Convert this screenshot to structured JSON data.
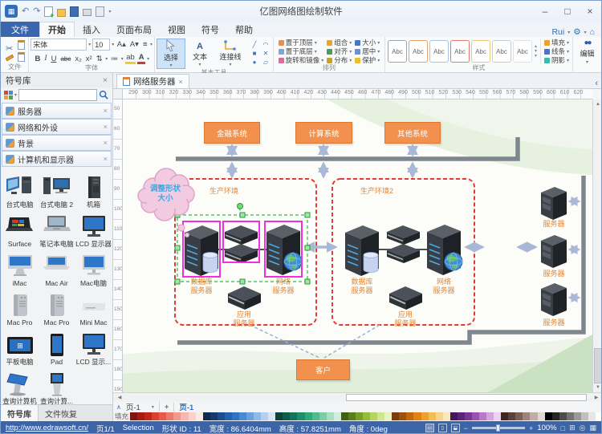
{
  "window": {
    "title": "亿图网络图绘制软件",
    "minimize": "–",
    "maximize": "□",
    "close": "×"
  },
  "menu": {
    "file_tab": "文件",
    "tabs": [
      "开始",
      "插入",
      "页面布局",
      "视图",
      "符号",
      "帮助"
    ],
    "active_tab": "开始",
    "account": "Rui",
    "gear": "⚙",
    "home": "⌂"
  },
  "ribbon": {
    "groups": {
      "file": "文件",
      "font": "字体",
      "tools": "基本工具",
      "arrange": "排列",
      "style": "样式"
    },
    "font": {
      "family": "宋体",
      "size": "10",
      "bold": "B",
      "italic": "I",
      "underline": "U",
      "strike": "abc",
      "sub": "x₂",
      "sup": "x²",
      "grow": "A▴",
      "shrink": "A▾",
      "align": "≡",
      "spacing": "⇅",
      "list": "≔",
      "highlight": "ab",
      "color": "A"
    },
    "tools": {
      "select": "选择",
      "text": "文本",
      "connector": "连接线",
      "shapes": [
        "╱",
        "◠",
        "■",
        "✕",
        "●",
        "▱"
      ]
    },
    "arrange_cols": [
      [
        {
          "label": "置于顶层",
          "color": "#e8914e"
        },
        {
          "label": "置于底层",
          "color": "#7aa7d8"
        },
        {
          "label": "旋转和镜像",
          "color": "#e06a9a"
        }
      ],
      [
        {
          "label": "组合",
          "color": "#e8a33c"
        },
        {
          "label": "对齐",
          "color": "#4a9e5c"
        },
        {
          "label": "分布",
          "color": "#c8a030"
        }
      ],
      [
        {
          "label": "大小",
          "color": "#4a74c8"
        },
        {
          "label": "居中",
          "color": "#6a8ed8"
        },
        {
          "label": "保护",
          "color": "#e8c030"
        }
      ]
    ],
    "style_samples": [
      {
        "label": "Abc",
        "border": "#9aa5ae"
      },
      {
        "label": "Abc",
        "border": "#e8a26a"
      },
      {
        "label": "Abc",
        "border": "#a8c4e0"
      },
      {
        "label": "Abc",
        "border": "#e07a6a"
      },
      {
        "label": "Abc",
        "border": "#e8cc7a"
      },
      {
        "label": "Abc",
        "border": "#c4ccd4"
      },
      {
        "label": "Abc",
        "border": "#dde2e6"
      }
    ],
    "style_tools": [
      {
        "label": "填充",
        "color": "#e8a23c"
      },
      {
        "label": "线条",
        "color": "#4a74c8"
      },
      {
        "label": "阴影",
        "color": "#3cb8a8"
      }
    ],
    "edit": "编辑"
  },
  "sidebar": {
    "title": "符号库",
    "close": "×",
    "sections": [
      {
        "label": "服务器"
      },
      {
        "label": "网络和外设"
      },
      {
        "label": "背景"
      },
      {
        "label": "计算机和显示器"
      }
    ],
    "items": [
      {
        "label": "台式电脑",
        "icon": "ic-desktop1"
      },
      {
        "label": "台式电脑 2",
        "icon": "ic-desktop2"
      },
      {
        "label": "机箱",
        "icon": "ic-case"
      },
      {
        "label": "Surface",
        "icon": "ic-surface"
      },
      {
        "label": "笔记本电脑",
        "icon": "ic-laptop"
      },
      {
        "label": "LCD 显示器",
        "icon": "ic-lcd"
      },
      {
        "label": "iMac",
        "icon": "ic-imac"
      },
      {
        "label": "Mac Air",
        "icon": "ic-macair"
      },
      {
        "label": "Mac电脑",
        "icon": "ic-macpc"
      },
      {
        "label": "Mac Pro",
        "icon": "ic-macpro"
      },
      {
        "label": "Mac Pro",
        "icon": "ic-macpro"
      },
      {
        "label": "Mini Mac",
        "icon": "ic-minimac"
      },
      {
        "label": "平板电脑",
        "icon": "ic-tablet"
      },
      {
        "label": "Pad",
        "icon": "ic-pad"
      },
      {
        "label": "LCD 显示...",
        "icon": "ic-lcd"
      },
      {
        "label": "查询计算机",
        "icon": "ic-kiosk"
      },
      {
        "label": "查询计算...",
        "icon": "ic-kiosk2"
      }
    ],
    "bottom_tabs": [
      "符号库",
      "文件恢复"
    ]
  },
  "document": {
    "tab_label": "网络服务器",
    "tab_close": "×",
    "back_chevron": "‹"
  },
  "rulers": {
    "h_start": 290,
    "h_step": 10,
    "h_count": 34,
    "v_start": 50,
    "v_step": 10,
    "v_count": 15
  },
  "pages": {
    "collapse": "∧",
    "dropdown": "页-1",
    "add": "+",
    "tab": "页-1"
  },
  "palette": {
    "label": "填充",
    "colors": [
      "#7f1410",
      "#a61c11",
      "#c2251a",
      "#d9402e",
      "#e55b4b",
      "#ec7b6d",
      "#f19a8f",
      "#f5b7af",
      "#f9d2cd",
      "#fce8e5",
      "#122a52",
      "#173a6e",
      "#1d4c8f",
      "#2561ad",
      "#2f74c4",
      "#4a8ad2",
      "#6ba1dd",
      "#8fb9e8",
      "#b4d0f0",
      "#d6e5f7",
      "#0b4436",
      "#0f5c49",
      "#15755c",
      "#1f8e6b",
      "#2fa87c",
      "#52ba90",
      "#7ccca8",
      "#a8dec2",
      "#d0eede",
      "#425f12",
      "#5b7e1c",
      "#769e28",
      "#94bc3a",
      "#b4d45e",
      "#d2e692",
      "#e9f2c2",
      "#7a3c08",
      "#9c520a",
      "#c0690c",
      "#e08312",
      "#eda02c",
      "#f4bc55",
      "#f8d488",
      "#fbe7b9",
      "#46175c",
      "#5d2478",
      "#793594",
      "#9a52b0",
      "#b87ac8",
      "#d4a6de",
      "#ecd2f0",
      "#3e2723",
      "#5d4037",
      "#7b5e53",
      "#9c837a",
      "#bfaea7",
      "#e0d6d2",
      "#000000",
      "#262626",
      "#4d4d4d",
      "#737373",
      "#999999",
      "#bfbfbf",
      "#e6e6e6",
      "#ffffff"
    ]
  },
  "status": {
    "link": "http://www.edrawsoft.cn/",
    "page": "页1/1",
    "mode": "Selection",
    "shape_id": "形状 ID : 11",
    "width": "宽度 : 86.6404mm",
    "height": "高度 : 57.8251mm",
    "angle": "角度 : 0deg",
    "zoom": "100%"
  },
  "diagram": {
    "systems": [
      "金融系统",
      "计算系统",
      "其他系统"
    ],
    "env1": {
      "label": "生产环境",
      "db": "数据库\n服务器",
      "net": "网络\n服务器",
      "app": "应用\n服务器"
    },
    "env2": {
      "label": "生产环境2",
      "db": "数据库\n服务器",
      "net": "网络\n服务器",
      "app": "应用\n服务器"
    },
    "right_servers": [
      "服务器",
      "服务器",
      "服务器"
    ],
    "client": "客户",
    "callout": "调整形状\n大小",
    "colors": {
      "box_fill": "#f1914d",
      "box_border": "#db7a33",
      "bus": "#7e868e",
      "arrow": "#a9b8d6",
      "env_border": "#e23a3a",
      "label": "#e0873a",
      "selection": "#35b44a",
      "handle": "#9fe8a0",
      "highlight": "#ee2fe2",
      "cloud_fill": "#f3cbe1",
      "cloud_border": "#dfa2ca",
      "cloud_text": "#3da6e0"
    }
  }
}
